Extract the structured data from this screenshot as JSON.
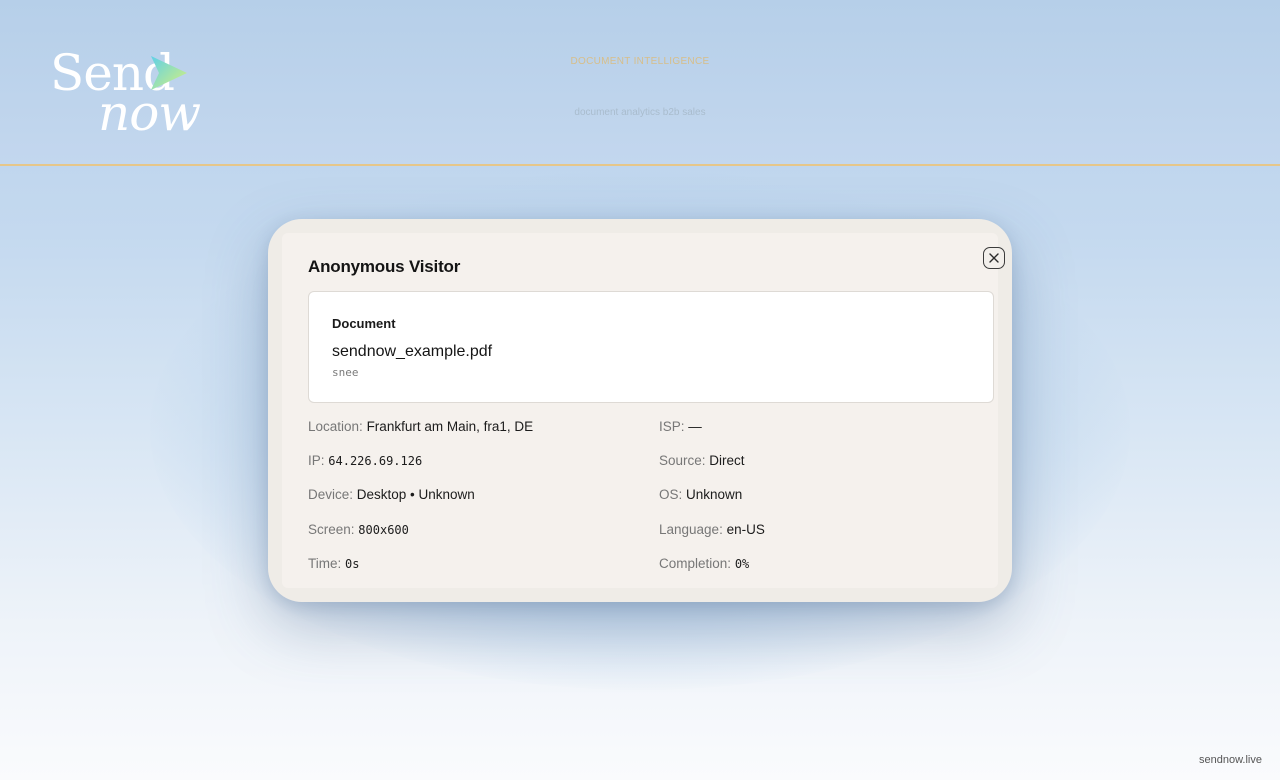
{
  "header": {
    "logo_word_top": "Send",
    "logo_word_bottom": "now",
    "tagline": "DOCUMENT INTELLIGENCE",
    "keywords": "document analytics b2b sales"
  },
  "colors": {
    "accent_gold": "#e6c689",
    "logo_arrow_gradient": [
      "#5fd0e8",
      "#d9f27a"
    ],
    "modal_background": "#efece7"
  },
  "modal": {
    "title": "Anonymous Visitor",
    "close_icon": "close-icon",
    "document": {
      "label": "Document",
      "filename": "sendnow_example.pdf",
      "sender": "snee"
    },
    "details": {
      "location": {
        "label": "Location:",
        "value": "Frankfurt am Main, fra1, DE"
      },
      "isp": {
        "label": "ISP:",
        "value": "—"
      },
      "ip": {
        "label": "IP:",
        "value": "64.226.69.126"
      },
      "source": {
        "label": "Source:",
        "value": "Direct"
      },
      "device": {
        "label": "Device:",
        "value": "Desktop • Unknown"
      },
      "os": {
        "label": "OS:",
        "value": "Unknown"
      },
      "screen": {
        "label": "Screen:",
        "value": "800x600"
      },
      "language": {
        "label": "Language:",
        "value": "en-US"
      },
      "time": {
        "label": "Time:",
        "value": "0s"
      },
      "completion": {
        "label": "Completion:",
        "value": "0%"
      }
    }
  },
  "footer": {
    "domain": "sendnow.live"
  }
}
